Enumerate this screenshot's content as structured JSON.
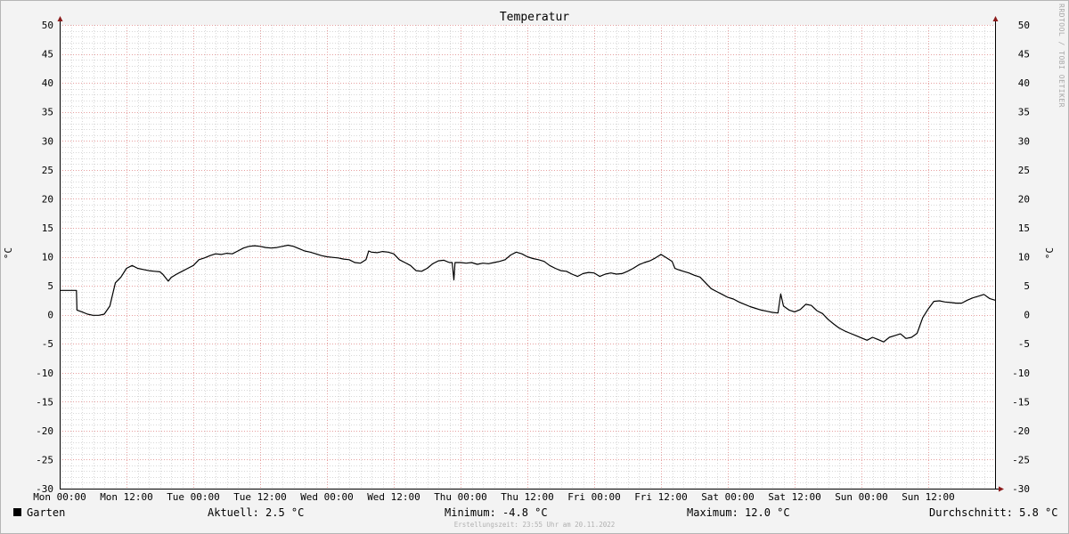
{
  "chart_data": {
    "type": "line",
    "title": "Temperatur",
    "ylabel": "°C",
    "ylim": [
      -30,
      50
    ],
    "y_ticks": [
      50,
      45,
      40,
      35,
      30,
      25,
      20,
      15,
      10,
      5,
      0,
      -5,
      -10,
      -15,
      -20,
      -25,
      -30
    ],
    "xlim_hours": [
      0,
      168
    ],
    "x_ticks": [
      {
        "hour": 0,
        "label": "Mon 00:00"
      },
      {
        "hour": 12,
        "label": "Mon 12:00"
      },
      {
        "hour": 24,
        "label": "Tue 00:00"
      },
      {
        "hour": 36,
        "label": "Tue 12:00"
      },
      {
        "hour": 48,
        "label": "Wed 00:00"
      },
      {
        "hour": 60,
        "label": "Wed 12:00"
      },
      {
        "hour": 72,
        "label": "Thu 00:00"
      },
      {
        "hour": 84,
        "label": "Thu 12:00"
      },
      {
        "hour": 96,
        "label": "Fri 00:00"
      },
      {
        "hour": 108,
        "label": "Fri 12:00"
      },
      {
        "hour": 120,
        "label": "Sat 00:00"
      },
      {
        "hour": 132,
        "label": "Sat 12:00"
      },
      {
        "hour": 144,
        "label": "Sun 00:00"
      },
      {
        "hour": 156,
        "label": "Sun 12:00"
      }
    ],
    "grid": true,
    "series": [
      {
        "name": "Garten",
        "color": "#000000",
        "points": [
          [
            0,
            4.2
          ],
          [
            3,
            4.2
          ],
          [
            3.1,
            0.8
          ],
          [
            4,
            0.5
          ],
          [
            5,
            0.1
          ],
          [
            6,
            -0.1
          ],
          [
            7,
            -0.1
          ],
          [
            8,
            0.1
          ],
          [
            9,
            1.5
          ],
          [
            10,
            5.5
          ],
          [
            11,
            6.5
          ],
          [
            12,
            8.0
          ],
          [
            13,
            8.5
          ],
          [
            14,
            8.0
          ],
          [
            15,
            7.8
          ],
          [
            16,
            7.6
          ],
          [
            17,
            7.5
          ],
          [
            18,
            7.4
          ],
          [
            18.5,
            7.0
          ],
          [
            19.5,
            5.8
          ],
          [
            20,
            6.4
          ],
          [
            21,
            7.0
          ],
          [
            22,
            7.5
          ],
          [
            23,
            8.0
          ],
          [
            24,
            8.5
          ],
          [
            25,
            9.5
          ],
          [
            26,
            9.8
          ],
          [
            27,
            10.2
          ],
          [
            28,
            10.5
          ],
          [
            29,
            10.4
          ],
          [
            30,
            10.6
          ],
          [
            31,
            10.5
          ],
          [
            32,
            11.0
          ],
          [
            33,
            11.5
          ],
          [
            34,
            11.8
          ],
          [
            35,
            11.9
          ],
          [
            36,
            11.8
          ],
          [
            37,
            11.6
          ],
          [
            38,
            11.5
          ],
          [
            39,
            11.6
          ],
          [
            40,
            11.8
          ],
          [
            41,
            12.0
          ],
          [
            42,
            11.8
          ],
          [
            43,
            11.4
          ],
          [
            44,
            11.0
          ],
          [
            45,
            10.8
          ],
          [
            46,
            10.5
          ],
          [
            47,
            10.2
          ],
          [
            48,
            10.0
          ],
          [
            49,
            9.9
          ],
          [
            50,
            9.8
          ],
          [
            51,
            9.6
          ],
          [
            52,
            9.5
          ],
          [
            53,
            9.0
          ],
          [
            54,
            8.9
          ],
          [
            55,
            9.5
          ],
          [
            55.5,
            11.0
          ],
          [
            56,
            10.8
          ],
          [
            57,
            10.7
          ],
          [
            58,
            10.9
          ],
          [
            59,
            10.8
          ],
          [
            60,
            10.5
          ],
          [
            61,
            9.5
          ],
          [
            62,
            9.0
          ],
          [
            63,
            8.5
          ],
          [
            64,
            7.6
          ],
          [
            65,
            7.5
          ],
          [
            66,
            8.0
          ],
          [
            67,
            8.8
          ],
          [
            68,
            9.3
          ],
          [
            69,
            9.4
          ],
          [
            70,
            9.0
          ],
          [
            70.5,
            9.0
          ],
          [
            70.8,
            6.0
          ],
          [
            71,
            9.0
          ],
          [
            72,
            9.0
          ],
          [
            73,
            8.9
          ],
          [
            74,
            9.0
          ],
          [
            75,
            8.7
          ],
          [
            76,
            8.9
          ],
          [
            77,
            8.8
          ],
          [
            78,
            9.0
          ],
          [
            79,
            9.2
          ],
          [
            80,
            9.5
          ],
          [
            81,
            10.3
          ],
          [
            82,
            10.8
          ],
          [
            83,
            10.5
          ],
          [
            84,
            10.0
          ],
          [
            85,
            9.7
          ],
          [
            86,
            9.5
          ],
          [
            87,
            9.2
          ],
          [
            88,
            8.5
          ],
          [
            89,
            8.0
          ],
          [
            90,
            7.6
          ],
          [
            91,
            7.5
          ],
          [
            92,
            7.0
          ],
          [
            93,
            6.6
          ],
          [
            94,
            7.1
          ],
          [
            95,
            7.3
          ],
          [
            96,
            7.2
          ],
          [
            97,
            6.6
          ],
          [
            98,
            7.0
          ],
          [
            99,
            7.2
          ],
          [
            100,
            7.0
          ],
          [
            101,
            7.1
          ],
          [
            102,
            7.5
          ],
          [
            103,
            8.0
          ],
          [
            104,
            8.6
          ],
          [
            105,
            9.0
          ],
          [
            106,
            9.3
          ],
          [
            107,
            9.8
          ],
          [
            108,
            10.4
          ],
          [
            109,
            9.8
          ],
          [
            110,
            9.2
          ],
          [
            110.5,
            8.0
          ],
          [
            111,
            7.8
          ],
          [
            112,
            7.5
          ],
          [
            113,
            7.2
          ],
          [
            114,
            6.8
          ],
          [
            115,
            6.5
          ],
          [
            116,
            5.5
          ],
          [
            117,
            4.5
          ],
          [
            118,
            4.0
          ],
          [
            119,
            3.5
          ],
          [
            120,
            3.0
          ],
          [
            121,
            2.7
          ],
          [
            122,
            2.2
          ],
          [
            123,
            1.8
          ],
          [
            124,
            1.4
          ],
          [
            125,
            1.1
          ],
          [
            126,
            0.8
          ],
          [
            127,
            0.6
          ],
          [
            128,
            0.4
          ],
          [
            129,
            0.3
          ],
          [
            129.5,
            3.6
          ],
          [
            130,
            1.5
          ],
          [
            131,
            0.8
          ],
          [
            132,
            0.5
          ],
          [
            133,
            0.9
          ],
          [
            134,
            1.8
          ],
          [
            135,
            1.6
          ],
          [
            136,
            0.7
          ],
          [
            137,
            0.2
          ],
          [
            138,
            -0.8
          ],
          [
            139,
            -1.6
          ],
          [
            140,
            -2.3
          ],
          [
            141,
            -2.8
          ],
          [
            142,
            -3.2
          ],
          [
            143,
            -3.6
          ],
          [
            144,
            -4.0
          ],
          [
            145,
            -4.4
          ],
          [
            146,
            -3.9
          ],
          [
            147,
            -4.3
          ],
          [
            148,
            -4.7
          ],
          [
            149,
            -3.9
          ],
          [
            150,
            -3.6
          ],
          [
            151,
            -3.3
          ],
          [
            152,
            -4.1
          ],
          [
            153,
            -3.9
          ],
          [
            154,
            -3.2
          ],
          [
            155,
            -0.5
          ],
          [
            156,
            1.0
          ],
          [
            157,
            2.3
          ],
          [
            158,
            2.4
          ],
          [
            159,
            2.2
          ],
          [
            160,
            2.1
          ],
          [
            161,
            2.0
          ],
          [
            162,
            2.0
          ],
          [
            163,
            2.5
          ],
          [
            164,
            2.9
          ],
          [
            165,
            3.2
          ],
          [
            166,
            3.5
          ],
          [
            167,
            2.8
          ],
          [
            168,
            2.5
          ]
        ]
      }
    ]
  },
  "watermark": "RRDTOOL / TOBI OETIKER",
  "legend": {
    "series_label": "Garten",
    "current": "Aktuell: 2.5 °C",
    "minimum": "Minimum: -4.8 °C",
    "maximum": "Maximum: 12.0 °C",
    "average": "Durchschnitt: 5.8 °C"
  },
  "footer": "Erstellungszeit: 23:55 Uhr am 20.11.2022",
  "colors": {
    "background": "#f3f3f3",
    "plot_area": "#ffffff",
    "minor_grid": "#d8d8d8",
    "major_grid": "#e6a0a0",
    "axis": "#000000",
    "arrow": "#8b1a1a",
    "line": "#000000"
  }
}
